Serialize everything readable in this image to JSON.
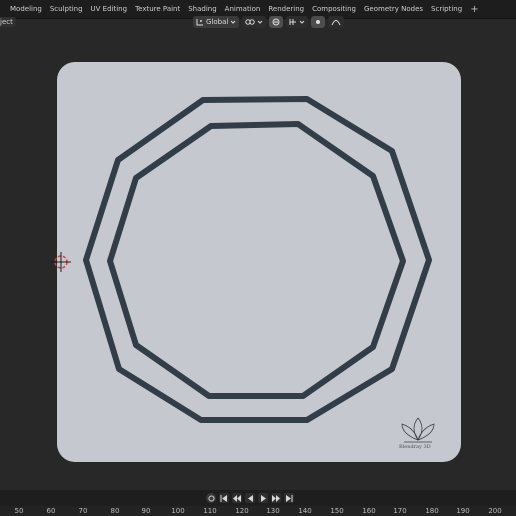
{
  "workspace_tabs": [
    "Modeling",
    "Sculpting",
    "UV Editing",
    "Texture Paint",
    "Shading",
    "Animation",
    "Rendering",
    "Compositing",
    "Geometry Nodes",
    "Scripting"
  ],
  "add_tab": "+",
  "viewport_header": {
    "mode_label": "ject",
    "transform_orientation": "Global"
  },
  "viewport": {
    "card_color": "#c5c9cf",
    "outline_color": "#323d48",
    "watermark_text": "Blendray 3D"
  },
  "timeline": {
    "ruler_ticks": [
      "50",
      "60",
      "70",
      "80",
      "90",
      "100",
      "110",
      "120",
      "130",
      "140",
      "150",
      "160",
      "170",
      "180",
      "190",
      "200"
    ]
  },
  "colors": {
    "background": "#282828",
    "header": "#1d1d1d",
    "cursor_red": "#d23c3c"
  }
}
